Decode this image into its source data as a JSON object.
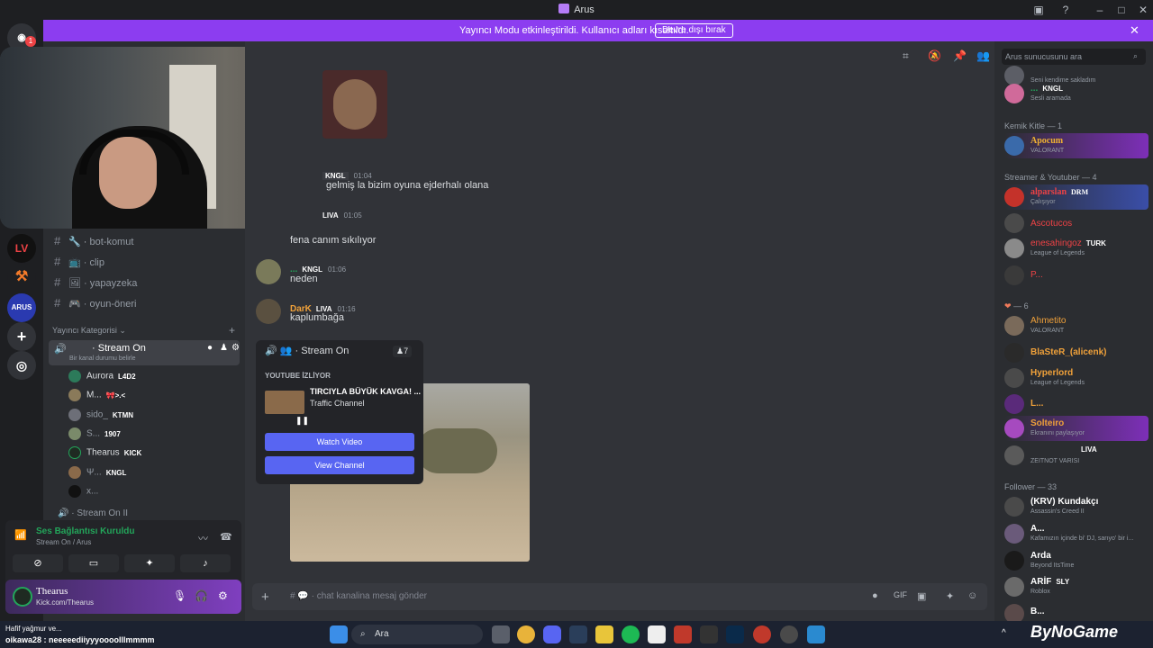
{
  "window": {
    "title": "Arus"
  },
  "banner": {
    "text": "Yayıncı Modu etkinleştirildi. Kullanıcı adları kısaltıldı.",
    "button": "Devre dışı bırak"
  },
  "rail": {
    "badge": "1",
    "arus_label": "ARUS"
  },
  "channels": [
    {
      "name": "bot-komut"
    },
    {
      "name": "clip"
    },
    {
      "name": "yapayzeka"
    },
    {
      "name": "oyun-öneri"
    }
  ],
  "category": {
    "label": "Yayıncı Kategorisi"
  },
  "voice_channel": {
    "name": "Stream On",
    "status": "Bir kanal durumu belirle",
    "next": "Stream On II"
  },
  "voice_members": [
    {
      "name": "Aurora",
      "tag": "L4D2"
    },
    {
      "name": "M...",
      "tag": "🎀>.<"
    },
    {
      "name": "sido_",
      "tag": "KTMN"
    },
    {
      "name": "S...",
      "tag": "1907"
    },
    {
      "name": "Thearus",
      "tag": "KICK"
    },
    {
      "name": "Ψ...",
      "tag": "KNGL"
    },
    {
      "name": "x...",
      "tag": ""
    }
  ],
  "voice_panel": {
    "status": "Ses Bağlantısı Kuruldu",
    "location": "Stream On / Arus"
  },
  "user_panel": {
    "name": "Thearus",
    "status": "Kick.com/Thearus"
  },
  "chat": {
    "messages": [
      {
        "name": "",
        "tag": "KNGL",
        "time": "01:04",
        "text": "gelmiş la bizim oyuna ejderhalı olana"
      },
      {
        "name": "",
        "tag": "LIVA",
        "time": "01:05",
        "text": "fena canım sıkılıyor"
      },
      {
        "name": "...",
        "tag": "KNGL",
        "time": "01:06",
        "text": "neden"
      },
      {
        "name": "DarK",
        "tag": "LIVA",
        "time": "01:16",
        "text": "kaplumbağa"
      }
    ],
    "input_placeholder": "chat kanalina mesaj gönder"
  },
  "popup": {
    "channel": "Stream On",
    "count": "7",
    "heading": "YOUTUBE İZLİYOR",
    "video_title": "TIRCIYLA BÜYÜK KAVGA! ...",
    "video_channel": "Traffic Channel",
    "watch": "Watch Video",
    "view": "View Channel"
  },
  "search": {
    "placeholder": "Arus sunucusunu ara"
  },
  "members": {
    "top": [
      {
        "name": "",
        "status": "Seni kendime sakladım"
      },
      {
        "name": "...",
        "role": "KNGL",
        "status": "Sesli aramada"
      }
    ],
    "cat1": "Kemik Kitle — 1",
    "kemik": [
      {
        "name": "Apocum",
        "status": "VALORANT",
        "color": "#f0b232"
      }
    ],
    "cat2": "Streamer & Youtuber — 4",
    "streamers": [
      {
        "name": "alparslan",
        "role": "DRM",
        "status": "Çalışıyor",
        "color": "#ed4245"
      },
      {
        "name": "Ascotucos",
        "status": "",
        "color": "#ed4245"
      },
      {
        "name": "enesahingoz",
        "role": "TURK",
        "status": "League of Legends",
        "color": "#ed4245"
      },
      {
        "name": "P...",
        "status": "",
        "color": "#ed4245"
      }
    ],
    "cat3": "— 6",
    "hearts": [
      {
        "name": "Ahmetito",
        "status": "VALORANT",
        "color": "#f0a13a"
      },
      {
        "name": "BlaSteR_(alicenk)",
        "status": "",
        "color": "#f0a13a"
      },
      {
        "name": "Hyperlord",
        "status": "League of Legends",
        "color": "#f0a13a"
      },
      {
        "name": "L...",
        "status": "",
        "color": "#f0a13a"
      },
      {
        "name": "Solteiro",
        "status": "Ekranını paylaşıyor",
        "color": "#f0a13a"
      },
      {
        "name": "",
        "role": "LIVA",
        "status": "ZEITNOT VARISI",
        "color": "#f0a13a"
      }
    ],
    "cat4": "Follower — 33",
    "followers": [
      {
        "name": "(KRV) Kundakçı",
        "status": "Assassin's Creed II",
        "color": "#ffffff"
      },
      {
        "name": "A...",
        "status": "Kafamızın içinde bi' DJ, sarıyo' bir i...",
        "color": "#ffffff"
      },
      {
        "name": "Arda",
        "status": "Beyond ItsTime",
        "color": "#ffffff"
      },
      {
        "name": "ARİF",
        "role": "SLY",
        "status": "Roblox",
        "color": "#ffffff"
      },
      {
        "name": "B...",
        "status": "",
        "color": "#ffffff"
      }
    ]
  },
  "stream_overlay": {
    "line1": "Hafif yağmur ve...",
    "line2": "oikawa28 : neeeeediiyyyooooIllmmmm",
    "watermark": "ByNoGame"
  },
  "taskbar": {
    "search": "Ara"
  },
  "colors": {
    "accent": "#8c3df0",
    "blurple": "#5865f2",
    "green": "#23a55a"
  }
}
